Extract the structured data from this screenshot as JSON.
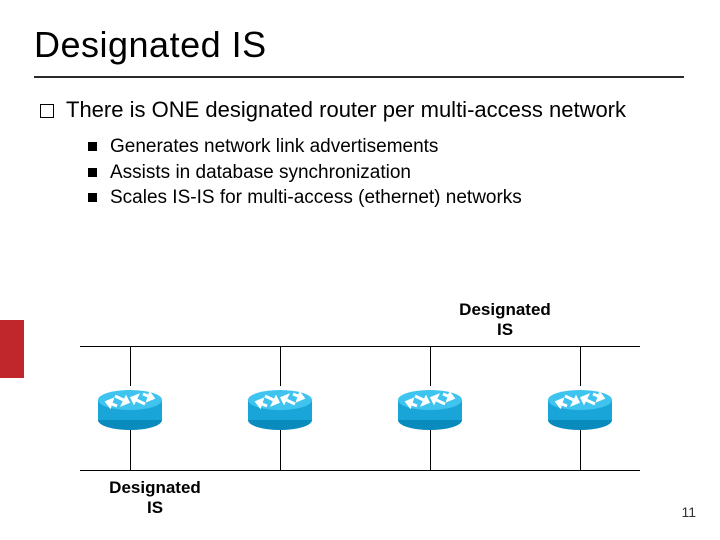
{
  "title": "Designated IS",
  "main_bullet": "There is ONE designated router per multi-access network",
  "sub_bullets": [
    "Generates network link advertisements",
    "Assists in database synchronization",
    "Scales IS-IS for multi-access (ethernet) networks"
  ],
  "diagram": {
    "top_label_line1": "Designated",
    "top_label_line2": "IS",
    "bottom_label_line1": "Designated",
    "bottom_label_line2": "IS"
  },
  "page_number": "11"
}
